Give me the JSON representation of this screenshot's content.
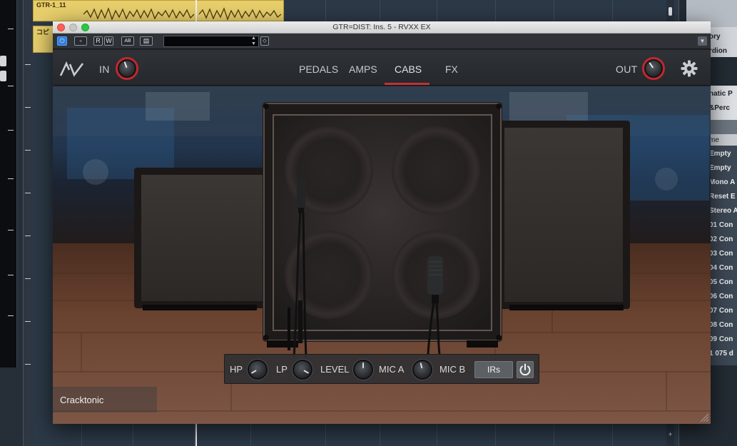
{
  "daw": {
    "clips": [
      {
        "label": "GTR-1_11"
      },
      {
        "label": "コピ"
      }
    ],
    "right_panel": {
      "items": [
        "ory",
        "rdion",
        "natic P",
        "&Perc",
        "me",
        "Empty",
        "Empty",
        "Mono A",
        "Reset E",
        "Stereo A",
        "01 Con",
        "02 Con",
        "03 Con",
        "04 Con",
        "05 Con",
        "06 Con",
        "07 Con",
        "08 Con",
        "09 Con",
        "1 075 d"
      ]
    }
  },
  "window": {
    "title": "GTR=DIST: Ins. 5 - RVXX EX",
    "host_buttons": {
      "power": "⏻",
      "compare": "▫",
      "read": "R",
      "write": "W",
      "ab": "AB",
      "preset_menu": "▤"
    },
    "preset_field": "",
    "colors": {
      "close": "#ff5f57",
      "minimize": "#c8c8c8",
      "zoom": "#28c840"
    }
  },
  "plugin": {
    "logo": "AV",
    "in_label": "IN",
    "out_label": "OUT",
    "tabs": [
      {
        "label": "PEDALS",
        "active": false
      },
      {
        "label": "AMPS",
        "active": false
      },
      {
        "label": "CABS",
        "active": true
      },
      {
        "label": "FX",
        "active": false
      }
    ],
    "accent_color": "#c53036",
    "brand": "Cracktonic",
    "controls": {
      "hp_label": "HP",
      "lp_label": "LP",
      "level_label": "LEVEL",
      "mic_a_label": "MIC A",
      "mic_b_label": "MIC B",
      "irs_label": "IRs"
    },
    "icons": [
      "gear-icon",
      "power-icon",
      "resize-grip-icon"
    ]
  }
}
